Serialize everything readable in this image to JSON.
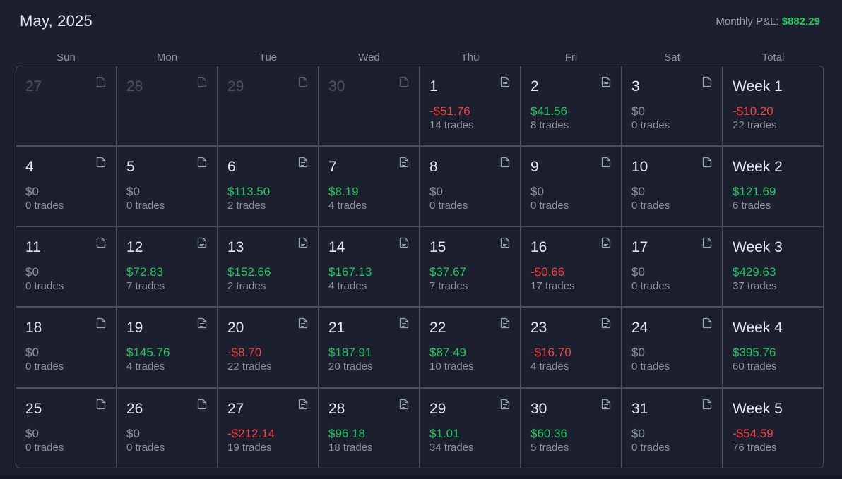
{
  "header": {
    "title": "May, 2025",
    "monthly_label": "Monthly P&L:",
    "monthly_value": "$882.29"
  },
  "weekdays": [
    "Sun",
    "Mon",
    "Tue",
    "Wed",
    "Thu",
    "Fri",
    "Sat",
    "Total"
  ],
  "colors": {
    "positive": "#22c55e",
    "negative": "#ef4444",
    "neutral": "#8b91a1"
  },
  "weeks": [
    {
      "days": [
        {
          "day": "27",
          "outside": true,
          "icon": "file-icon"
        },
        {
          "day": "28",
          "outside": true,
          "icon": "file-icon"
        },
        {
          "day": "29",
          "outside": true,
          "icon": "file-icon"
        },
        {
          "day": "30",
          "outside": true,
          "icon": "file-icon"
        },
        {
          "day": "1",
          "amount": "-$51.76",
          "trades": "14 trades",
          "sign": "neg",
          "icon": "file-text-icon"
        },
        {
          "day": "2",
          "amount": "$41.56",
          "trades": "8 trades",
          "sign": "pos",
          "icon": "file-text-icon"
        },
        {
          "day": "3",
          "amount": "$0",
          "trades": "0 trades",
          "sign": "zero",
          "icon": "file-icon"
        }
      ],
      "total": {
        "label": "Week 1",
        "amount": "-$10.20",
        "trades": "22 trades",
        "sign": "neg"
      }
    },
    {
      "days": [
        {
          "day": "4",
          "amount": "$0",
          "trades": "0 trades",
          "sign": "zero",
          "icon": "file-icon"
        },
        {
          "day": "5",
          "amount": "$0",
          "trades": "0 trades",
          "sign": "zero",
          "icon": "file-icon"
        },
        {
          "day": "6",
          "amount": "$113.50",
          "trades": "2 trades",
          "sign": "pos",
          "icon": "file-text-icon"
        },
        {
          "day": "7",
          "amount": "$8.19",
          "trades": "4 trades",
          "sign": "pos",
          "icon": "file-text-icon"
        },
        {
          "day": "8",
          "amount": "$0",
          "trades": "0 trades",
          "sign": "zero",
          "icon": "file-icon"
        },
        {
          "day": "9",
          "amount": "$0",
          "trades": "0 trades",
          "sign": "zero",
          "icon": "file-icon"
        },
        {
          "day": "10",
          "amount": "$0",
          "trades": "0 trades",
          "sign": "zero",
          "icon": "file-icon"
        }
      ],
      "total": {
        "label": "Week 2",
        "amount": "$121.69",
        "trades": "6 trades",
        "sign": "pos"
      }
    },
    {
      "days": [
        {
          "day": "11",
          "amount": "$0",
          "trades": "0 trades",
          "sign": "zero",
          "icon": "file-icon"
        },
        {
          "day": "12",
          "amount": "$72.83",
          "trades": "7 trades",
          "sign": "pos",
          "icon": "file-text-icon"
        },
        {
          "day": "13",
          "amount": "$152.66",
          "trades": "2 trades",
          "sign": "pos",
          "icon": "file-text-icon"
        },
        {
          "day": "14",
          "amount": "$167.13",
          "trades": "4 trades",
          "sign": "pos",
          "icon": "file-text-icon"
        },
        {
          "day": "15",
          "amount": "$37.67",
          "trades": "7 trades",
          "sign": "pos",
          "icon": "file-text-icon"
        },
        {
          "day": "16",
          "amount": "-$0.66",
          "trades": "17 trades",
          "sign": "neg",
          "icon": "file-text-icon"
        },
        {
          "day": "17",
          "amount": "$0",
          "trades": "0 trades",
          "sign": "zero",
          "icon": "file-icon"
        }
      ],
      "total": {
        "label": "Week 3",
        "amount": "$429.63",
        "trades": "37 trades",
        "sign": "pos"
      }
    },
    {
      "days": [
        {
          "day": "18",
          "amount": "$0",
          "trades": "0 trades",
          "sign": "zero",
          "icon": "file-icon"
        },
        {
          "day": "19",
          "amount": "$145.76",
          "trades": "4 trades",
          "sign": "pos",
          "icon": "file-text-icon"
        },
        {
          "day": "20",
          "amount": "-$8.70",
          "trades": "22 trades",
          "sign": "neg",
          "icon": "file-text-icon"
        },
        {
          "day": "21",
          "amount": "$187.91",
          "trades": "20 trades",
          "sign": "pos",
          "icon": "file-text-icon"
        },
        {
          "day": "22",
          "amount": "$87.49",
          "trades": "10 trades",
          "sign": "pos",
          "icon": "file-text-icon"
        },
        {
          "day": "23",
          "amount": "-$16.70",
          "trades": "4 trades",
          "sign": "neg",
          "icon": "file-text-icon"
        },
        {
          "day": "24",
          "amount": "$0",
          "trades": "0 trades",
          "sign": "zero",
          "icon": "file-icon"
        }
      ],
      "total": {
        "label": "Week 4",
        "amount": "$395.76",
        "trades": "60 trades",
        "sign": "pos"
      }
    },
    {
      "days": [
        {
          "day": "25",
          "amount": "$0",
          "trades": "0 trades",
          "sign": "zero",
          "icon": "file-icon"
        },
        {
          "day": "26",
          "amount": "$0",
          "trades": "0 trades",
          "sign": "zero",
          "icon": "file-icon"
        },
        {
          "day": "27",
          "amount": "-$212.14",
          "trades": "19 trades",
          "sign": "neg",
          "icon": "file-text-icon"
        },
        {
          "day": "28",
          "amount": "$96.18",
          "trades": "18 trades",
          "sign": "pos",
          "icon": "file-text-icon"
        },
        {
          "day": "29",
          "amount": "$1.01",
          "trades": "34 trades",
          "sign": "pos",
          "icon": "file-text-icon"
        },
        {
          "day": "30",
          "amount": "$60.36",
          "trades": "5 trades",
          "sign": "pos",
          "icon": "file-text-icon"
        },
        {
          "day": "31",
          "amount": "$0",
          "trades": "0 trades",
          "sign": "zero",
          "icon": "file-icon"
        }
      ],
      "total": {
        "label": "Week 5",
        "amount": "-$54.59",
        "trades": "76 trades",
        "sign": "neg"
      }
    }
  ]
}
